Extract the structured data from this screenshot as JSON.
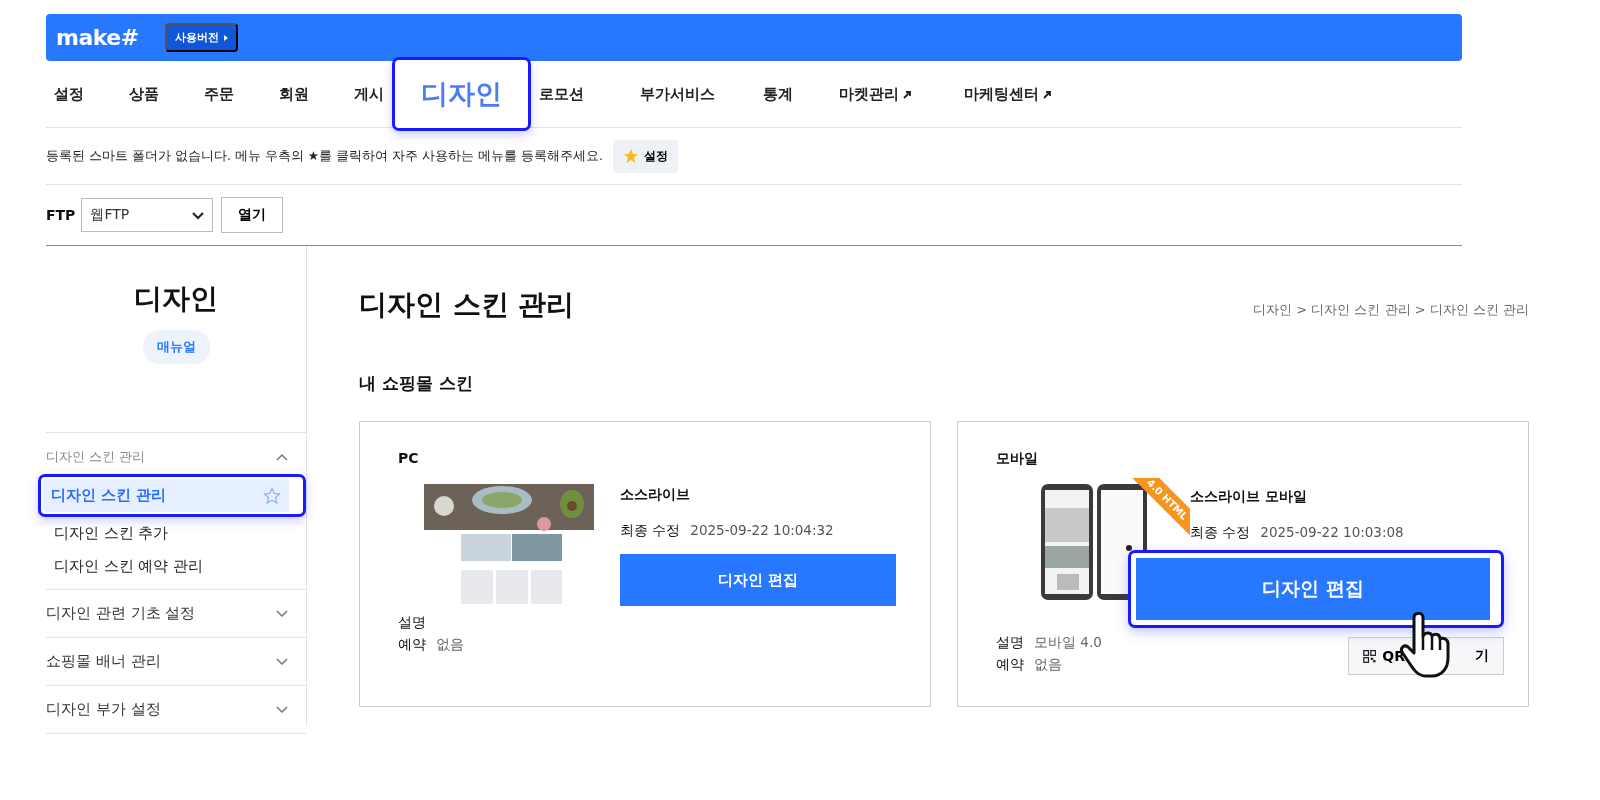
{
  "header": {
    "logo": "make#",
    "version_badge": "사용버전"
  },
  "nav": [
    {
      "kind": "menu",
      "label": "설정",
      "external": false
    },
    {
      "kind": "menu",
      "label": "상품",
      "external": false
    },
    {
      "kind": "menu",
      "label": "주문",
      "external": false
    },
    {
      "kind": "menu",
      "label": "회원",
      "external": false
    },
    {
      "kind": "menu",
      "label": "게시",
      "external": false
    },
    {
      "kind": "callout",
      "label": "디자인"
    },
    {
      "kind": "menu",
      "label": "로모션",
      "external": false
    },
    {
      "kind": "menu",
      "label": "부가서비스",
      "external": false
    },
    {
      "kind": "menu",
      "label": "통계",
      "external": false
    },
    {
      "kind": "menu",
      "label": "마켓관리",
      "external": true
    },
    {
      "kind": "menu",
      "label": "마케팅센터",
      "external": true
    }
  ],
  "smart_folder": {
    "message": "등록된 스마트 폴더가 없습니다. 메뉴 우측의 ★를 클릭하여 자주 사용하는 메뉴를 등록해주세요.",
    "button": "설정"
  },
  "ftp": {
    "label": "FTP",
    "value": "웹FTP",
    "button": "열기"
  },
  "sidebar": {
    "title": "디자인",
    "manual": "매뉴얼",
    "groups": [
      {
        "label": "디자인 스킨 관리",
        "expanded": true,
        "items": [
          {
            "label": "디자인 스킨 관리",
            "selected": true,
            "highlighted": true
          },
          {
            "label": "디자인 스킨 추가",
            "selected": false,
            "highlighted": false
          },
          {
            "label": "디자인 스킨 예약 관리",
            "selected": false,
            "highlighted": false
          }
        ]
      },
      {
        "label": "디자인 관련 기초 설정",
        "expanded": false
      },
      {
        "label": "쇼핑몰 배너 관리",
        "expanded": false
      },
      {
        "label": "디자인 부가 설정",
        "expanded": false
      }
    ]
  },
  "main": {
    "title": "디자인 스킨 관리",
    "breadcrumb": "디자인 > 디자인 스킨 관리 > 디자인 스킨 관리",
    "section": "내 쇼핑몰 스킨",
    "cards": [
      {
        "kind": "pc",
        "platform": "PC",
        "name": "소스라이브",
        "modified_label": "최종 수정",
        "modified": "2025-09-22 10:04:32",
        "edit_button": "디자인 편집",
        "highlighted": false,
        "pointer": false,
        "description_label": "설명",
        "reservation_label": "예약",
        "reservation": "없음"
      },
      {
        "kind": "mobile",
        "platform": "모바일",
        "ribbon": "4.0 HTML",
        "name": "소스라이브 모바일",
        "modified_label": "최종 수정",
        "modified": "2025-09-22 10:03:08",
        "edit_button": "디자인 편집",
        "highlighted": true,
        "pointer": true,
        "description_label": "설명",
        "description": "모바일 4.0",
        "reservation_label": "예약",
        "reservation": "없음",
        "qr_button": [
          "QR",
          "기"
        ]
      }
    ]
  }
}
